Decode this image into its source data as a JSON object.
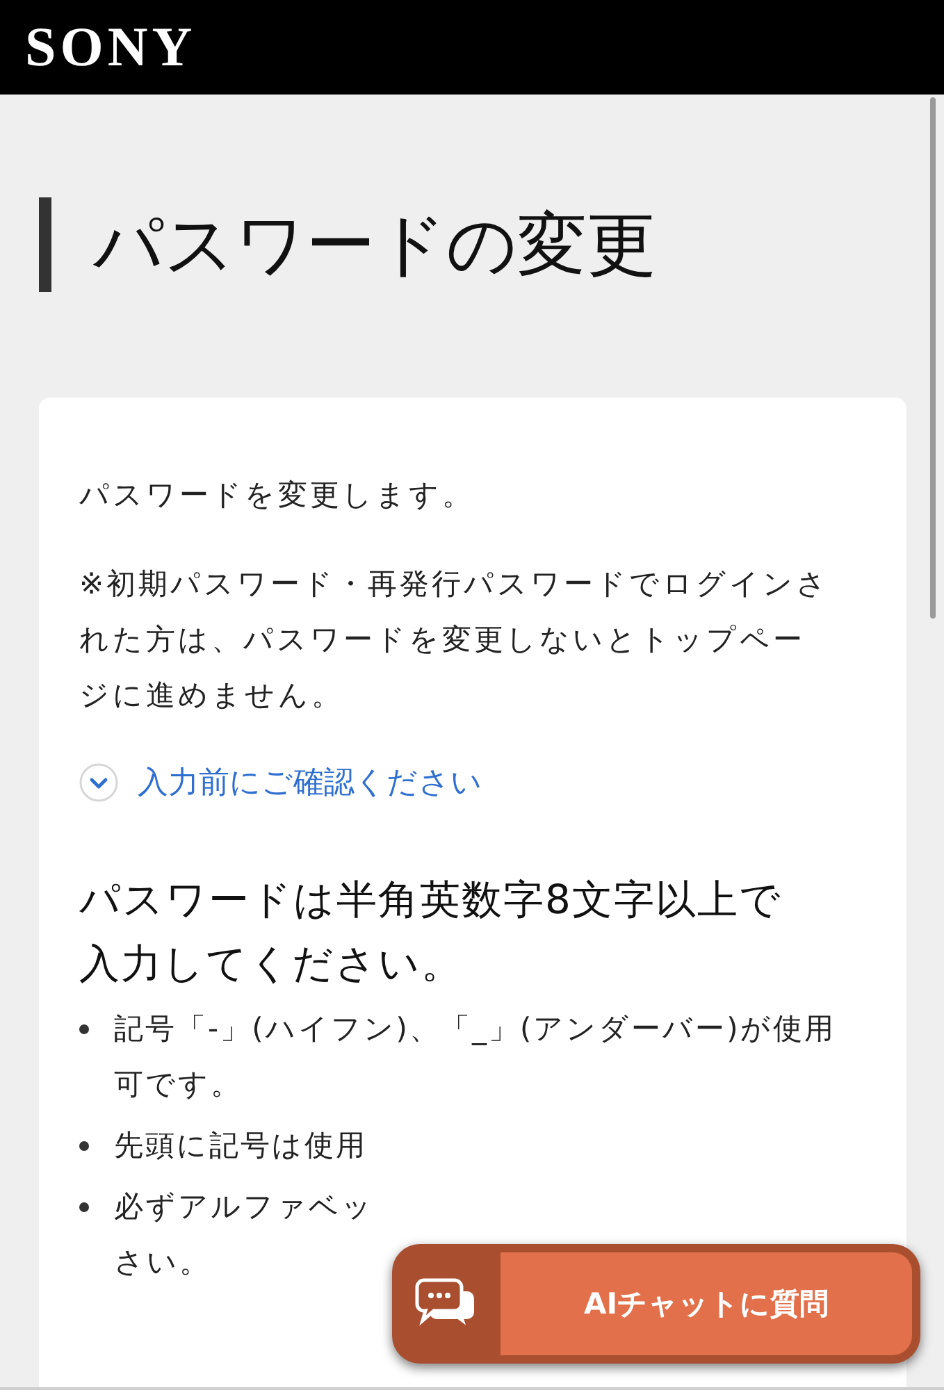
{
  "header": {
    "logo": "SONY"
  },
  "page_title": "パスワードの変更",
  "card": {
    "intro": "パスワードを変更します。",
    "note": "※初期パスワード・再発行パスワードでログインされた方は、パスワードを変更しないとトップページに進めません。",
    "disclosure": {
      "label": "入力前にご確認ください",
      "expanded": false
    },
    "rule_heading": "パスワードは半角英数字8文字以上で入力してください。",
    "rules": [
      [
        "記号「-」(ハイフン)、「_」(アンダーバー)が使用可です。"
      ],
      [
        "先頭に記号は使用"
      ],
      [
        "必ずアルファベッ",
        "さい。"
      ]
    ]
  },
  "chat_button": {
    "label": "AIチャットに質問"
  }
}
